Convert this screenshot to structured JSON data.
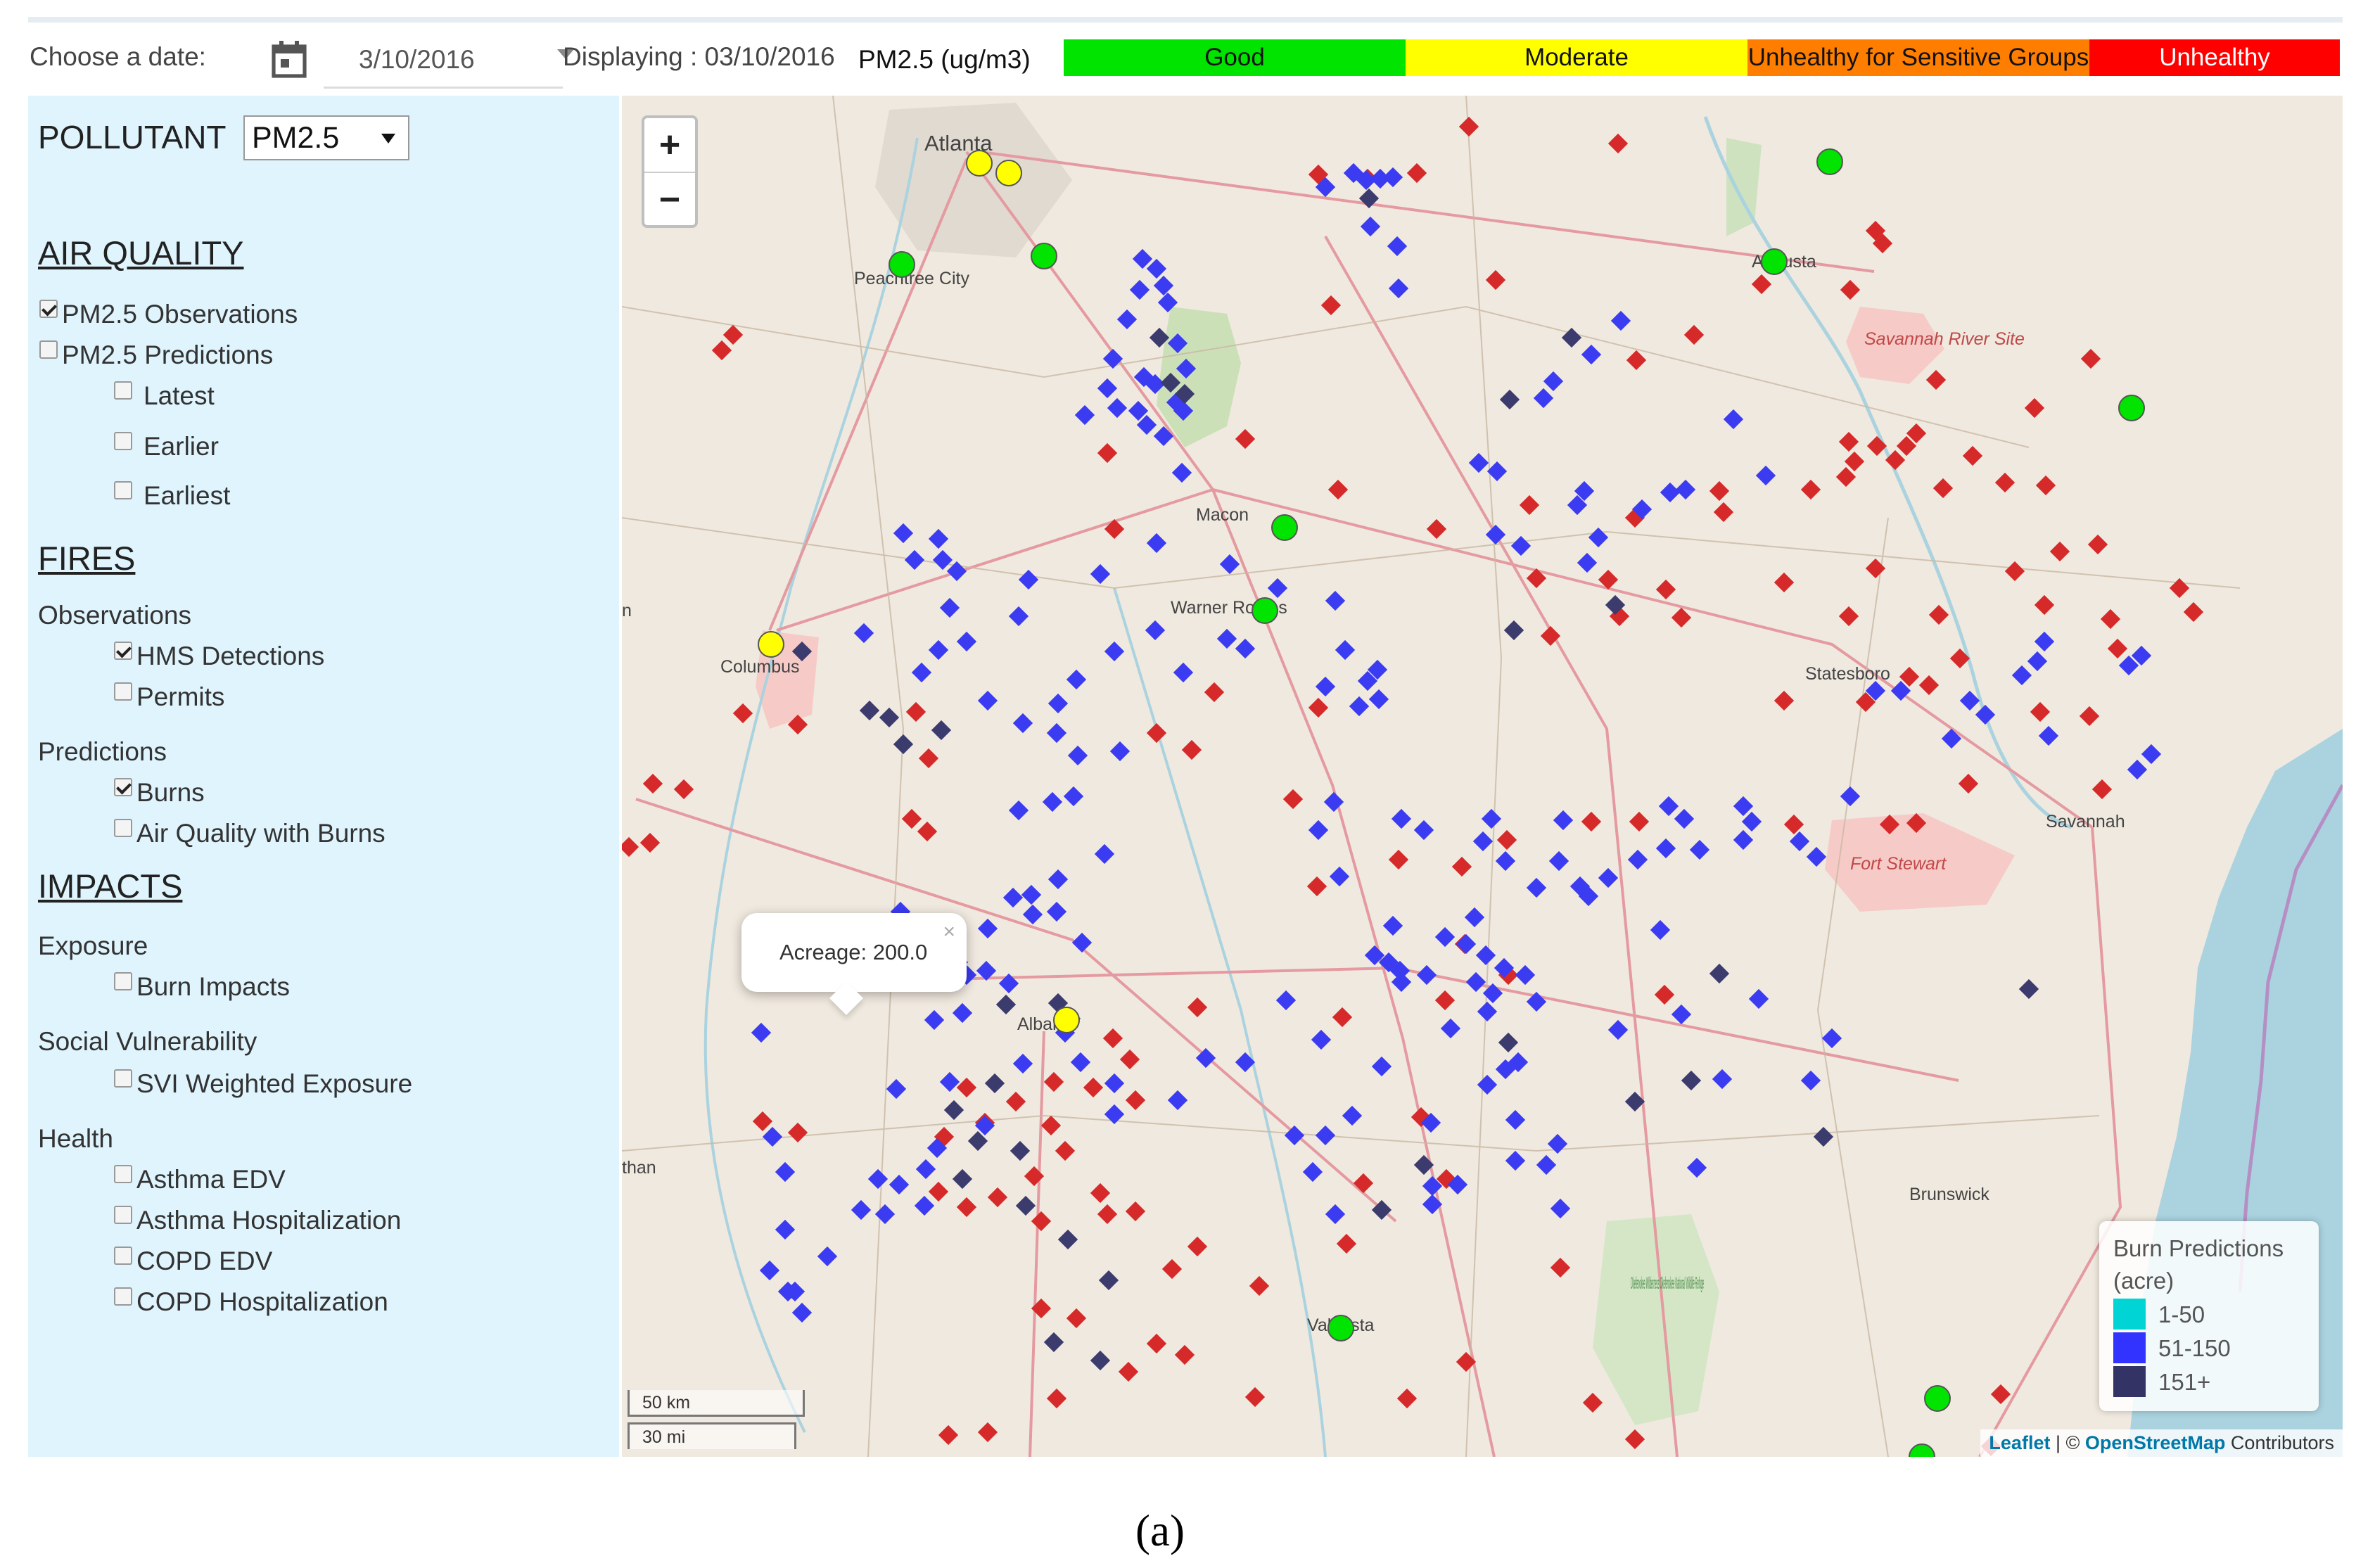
{
  "topbar": {
    "choose_label": "Choose a date:",
    "date_value": "3/10/2016",
    "displaying_label": "Displaying : 03/10/2016",
    "unit_label": "PM2.5 (ug/m3)",
    "aqi_categories": [
      {
        "label": "Good",
        "color": "#00e400"
      },
      {
        "label": "Moderate",
        "color": "#ffff00"
      },
      {
        "label": "Unhealthy for Sensitive Groups",
        "color": "#ff7e00"
      },
      {
        "label": "Unhealthy",
        "color": "#ff0000"
      }
    ]
  },
  "panel": {
    "pollutant_label": "POLLUTANT",
    "pollutant_value": "PM2.5",
    "air_quality": {
      "heading": "AIR QUALITY",
      "observations": "PM2.5 Observations",
      "predictions": "PM2.5 Predictions",
      "latest": "Latest",
      "earlier": "Earlier",
      "earliest": "Earliest"
    },
    "fires": {
      "heading": "FIRES",
      "observations": "Observations",
      "hms": "HMS Detections",
      "permits": "Permits",
      "predictions": "Predictions",
      "burns": "Burns",
      "aq_burns": "Air Quality with Burns"
    },
    "impacts": {
      "heading": "IMPACTS",
      "exposure": "Exposure",
      "burn_impacts": "Burn Impacts",
      "social": "Social Vulnerability",
      "svi": "SVI Weighted Exposure",
      "health": "Health",
      "asthma_edv": "Asthma EDV",
      "asthma_hosp": "Asthma Hospitalization",
      "copd_edv": "COPD EDV",
      "copd_hosp": "COPD Hospitalization"
    }
  },
  "map": {
    "zoom_in": "+",
    "zoom_out": "−",
    "popup_text": "Acreage: 200.0",
    "popup_close": "×",
    "cities": {
      "atlanta": "Atlanta",
      "peachtree": "Peachtree City",
      "augusta": "Augusta",
      "savannah_river": "Savannah River Site",
      "macon": "Macon",
      "warner_robins": "Warner Robins",
      "columbus": "Columbus",
      "statesboro": "Statesboro",
      "savannah": "Savannah",
      "fort_stewart": "Fort Stewart",
      "albany": "Albany",
      "brunswick": "Brunswick",
      "valdosta": "Valdosta",
      "okefenokee": "Okefenokee Wilderness Okefenokee National Wildlife Refuge",
      "edge_n": "n",
      "edge_than": "than"
    },
    "legend": {
      "title1": "Burn Predictions",
      "title2": "(acre)",
      "items": [
        {
          "label": "1-50",
          "color": "#00d4d4"
        },
        {
          "label": "51-150",
          "color": "#3333ff"
        },
        {
          "label": "151+",
          "color": "#333366"
        }
      ]
    },
    "scale_km": "50 km",
    "scale_mi": "30 mi",
    "attribution_leaflet": "Leaflet",
    "attribution_sep": " | © ",
    "attribution_osm": "OpenStreetMap",
    "attribution_rest": " Contributors",
    "colors": {
      "hms": "#d62a2a",
      "burn_mid": "#3b3bf2",
      "burn_high": "#3b3b6e",
      "good": "#00e400",
      "moderate": "#ffff00"
    }
  },
  "figure_label": "(a)"
}
